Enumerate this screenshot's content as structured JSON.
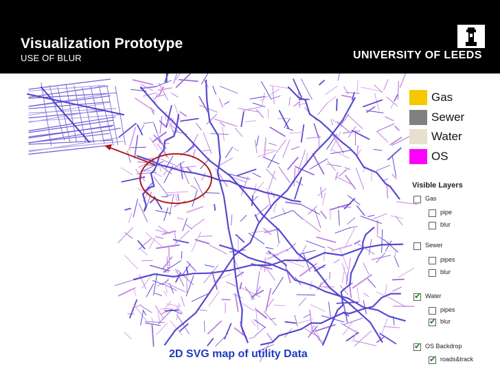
{
  "header": {
    "title": "Visualization Prototype",
    "subtitle": "USE OF BLUR",
    "university": "UNIVERSITY OF LEEDS",
    "background": "#000000",
    "logo_icon": "leeds-tower-icon"
  },
  "legend": {
    "items": [
      {
        "label": "Gas",
        "color": "#f5c800"
      },
      {
        "label": "Sewer",
        "color": "#808080"
      },
      {
        "label": "Water",
        "color": "#e8e0cf"
      },
      {
        "label": "OS",
        "color": "#ff00ff"
      }
    ]
  },
  "layers": {
    "title": "Visible Layers",
    "rows": [
      {
        "label": "Gas",
        "checked": false,
        "indent": 0
      },
      {
        "label": "pipe",
        "checked": false,
        "indent": 1
      },
      {
        "label": "blur",
        "checked": false,
        "indent": 1
      },
      {
        "label": "Sewer",
        "checked": false,
        "indent": 0
      },
      {
        "label": "pipes",
        "checked": false,
        "indent": 1
      },
      {
        "label": "blur",
        "checked": false,
        "indent": 1
      },
      {
        "label": "Water",
        "checked": true,
        "indent": 0
      },
      {
        "label": "pipes",
        "checked": false,
        "indent": 1
      },
      {
        "label": "blur",
        "checked": true,
        "indent": 1
      },
      {
        "label": "OS Backdrop",
        "checked": true,
        "indent": 0
      },
      {
        "label": "roads&track",
        "checked": true,
        "indent": 1
      }
    ]
  },
  "map": {
    "caption": "2D SVG map of utility Data",
    "highlight_color": "#b01818",
    "road_colors": [
      "#d9a0e6",
      "#9a6ad8",
      "#5a4ad0",
      "#c080e0"
    ]
  }
}
